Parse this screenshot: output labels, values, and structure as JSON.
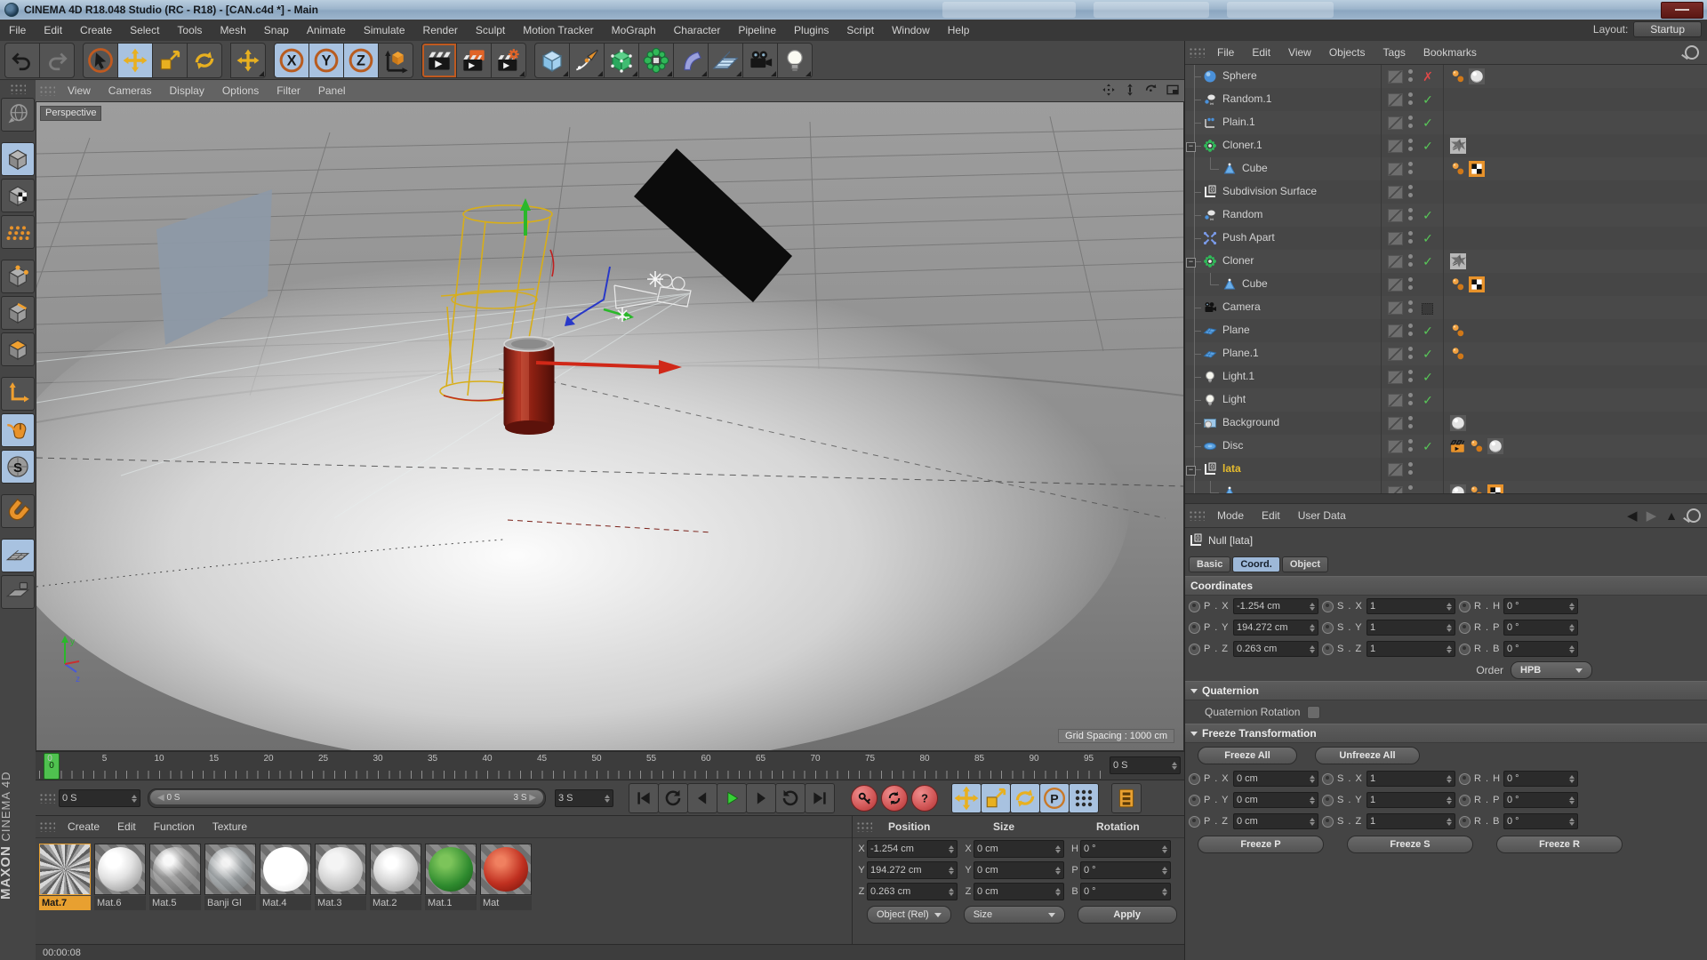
{
  "window": {
    "title": "CINEMA 4D R18.048 Studio (RC - R18) - [CAN.c4d *] - Main"
  },
  "menubar": {
    "items": [
      "File",
      "Edit",
      "Create",
      "Select",
      "Tools",
      "Mesh",
      "Snap",
      "Animate",
      "Simulate",
      "Render",
      "Sculpt",
      "Motion Tracker",
      "MoGraph",
      "Character",
      "Pipeline",
      "Plugins",
      "Script",
      "Window",
      "Help"
    ],
    "layout_label": "Layout:",
    "layout_value": "Startup"
  },
  "toolbar": {
    "tools": [
      {
        "name": "undo"
      },
      {
        "name": "redo",
        "disabled": true
      },
      {
        "name": "live-select"
      },
      {
        "name": "move",
        "active": true
      },
      {
        "name": "scale"
      },
      {
        "name": "rotate"
      },
      {
        "name": "last-tool-move"
      },
      {
        "name": "lock-x",
        "active": true
      },
      {
        "name": "lock-y",
        "active": true
      },
      {
        "name": "lock-z",
        "active": true
      },
      {
        "name": "coord-system"
      },
      {
        "name": "render-view",
        "framed": true
      },
      {
        "name": "render-picture-viewer"
      },
      {
        "name": "render-settings"
      },
      {
        "name": "primitive-cube"
      },
      {
        "name": "spline-pen"
      },
      {
        "name": "subdivision-surface"
      },
      {
        "name": "mograph"
      },
      {
        "name": "deformer"
      },
      {
        "name": "environment"
      },
      {
        "name": "scene-camera"
      },
      {
        "name": "scene-light"
      }
    ]
  },
  "left_toolbar": {
    "tools": [
      {
        "name": "convert-object"
      },
      {
        "name": "model-mode",
        "active": true
      },
      {
        "name": "texture-mode"
      },
      {
        "name": "workplane-paint"
      },
      {
        "name": "points-mode"
      },
      {
        "name": "edges-mode"
      },
      {
        "name": "polygons-mode"
      },
      {
        "name": "axis-mode"
      },
      {
        "name": "viewport-solo",
        "active": true
      },
      {
        "name": "snap",
        "active": true
      },
      {
        "name": "magnet-snap"
      },
      {
        "name": "workplane-lock",
        "active": true
      },
      {
        "name": "workplane"
      }
    ]
  },
  "viewport": {
    "menu_items": [
      "View",
      "Cameras",
      "Display",
      "Options",
      "Filter",
      "Panel"
    ],
    "camera_label": "Perspective",
    "grid_spacing": "Grid Spacing : 1000 cm",
    "corner_icons": [
      "pan-icon",
      "zoom-icon",
      "rotate-icon",
      "toggle-view-icon"
    ]
  },
  "timeline": {
    "tick_labels": [
      "0",
      "5",
      "10",
      "15",
      "20",
      "25",
      "30",
      "35",
      "40",
      "45",
      "50",
      "55",
      "60",
      "65",
      "70",
      "75",
      "80",
      "85",
      "90",
      "95"
    ],
    "playhead_value": "0",
    "end_field": "0 S",
    "current_field": "0 S",
    "range_start": "0 S",
    "range_end": "3 S",
    "duration_field": "3 S"
  },
  "object_manager": {
    "menu_items": [
      "File",
      "Edit",
      "View",
      "Objects",
      "Tags",
      "Bookmarks"
    ],
    "objects": [
      {
        "name": "Sphere",
        "icon": "sphere",
        "indent": 0,
        "expand": null,
        "state": "x",
        "tags": [
          "phong",
          "material"
        ]
      },
      {
        "name": "Random.1",
        "icon": "effector",
        "indent": 0,
        "expand": null,
        "state": "check",
        "tags": []
      },
      {
        "name": "Plain.1",
        "icon": "plain",
        "indent": 0,
        "expand": null,
        "state": "check",
        "tags": []
      },
      {
        "name": "Cloner.1",
        "icon": "cloner",
        "indent": 0,
        "expand": "minus",
        "state": "check",
        "tags": [
          "texture"
        ]
      },
      {
        "name": "Cube",
        "icon": "cone",
        "indent": 1,
        "expand": null,
        "state": "none",
        "tags": [
          "phong",
          "compositing"
        ]
      },
      {
        "name": "Subdivision Surface",
        "icon": "null",
        "indent": 0,
        "expand": null,
        "state": "none",
        "tags": []
      },
      {
        "name": "Random",
        "icon": "effector",
        "indent": 0,
        "expand": null,
        "state": "check",
        "tags": []
      },
      {
        "name": "Push Apart",
        "icon": "pushapart",
        "indent": 0,
        "expand": null,
        "state": "check",
        "tags": []
      },
      {
        "name": "Cloner",
        "icon": "cloner",
        "indent": 0,
        "expand": "minus",
        "state": "check",
        "tags": [
          "texture"
        ]
      },
      {
        "name": "Cube",
        "icon": "cone",
        "indent": 1,
        "expand": null,
        "state": "none",
        "tags": [
          "phong",
          "compositing"
        ]
      },
      {
        "name": "Camera",
        "icon": "camera",
        "indent": 0,
        "expand": null,
        "state": "cam",
        "tags": []
      },
      {
        "name": "Plane",
        "icon": "plane",
        "indent": 0,
        "expand": null,
        "state": "check",
        "tags": [
          "phong"
        ]
      },
      {
        "name": "Plane.1",
        "icon": "plane",
        "indent": 0,
        "expand": null,
        "state": "check",
        "tags": [
          "phong"
        ]
      },
      {
        "name": "Light.1",
        "icon": "light",
        "indent": 0,
        "expand": null,
        "state": "check",
        "tags": []
      },
      {
        "name": "Light",
        "icon": "light",
        "indent": 0,
        "expand": null,
        "state": "check",
        "tags": []
      },
      {
        "name": "Background",
        "icon": "background",
        "indent": 0,
        "expand": null,
        "state": "none",
        "tags": [
          "material"
        ]
      },
      {
        "name": "Disc",
        "icon": "disc",
        "indent": 0,
        "expand": null,
        "state": "check",
        "tags": [
          "render",
          "phong",
          "material"
        ]
      },
      {
        "name": "lata",
        "icon": "null",
        "indent": 0,
        "expand": "minus",
        "state": "none",
        "selected": true,
        "tags": []
      },
      {
        "name": "",
        "icon": "cone",
        "indent": 1,
        "expand": null,
        "state": "none",
        "tags": [
          "material",
          "phong",
          "compositing"
        ]
      }
    ]
  },
  "attribute_manager": {
    "menu_items": [
      "Mode",
      "Edit",
      "User Data"
    ],
    "object_title": "Null [lata]",
    "tabs": [
      {
        "label": "Basic",
        "active": false
      },
      {
        "label": "Coord.",
        "active": true
      },
      {
        "label": "Object",
        "active": false
      }
    ],
    "coordinates_section": "Coordinates",
    "coord_rows": [
      {
        "p_label": "P . X",
        "p_value": "-1.254 cm",
        "s_label": "S . X",
        "s_value": "1",
        "r_label": "R . H",
        "r_value": "0 °"
      },
      {
        "p_label": "P . Y",
        "p_value": "194.272 cm",
        "s_label": "S . Y",
        "s_value": "1",
        "r_label": "R . P",
        "r_value": "0 °"
      },
      {
        "p_label": "P . Z",
        "p_value": "0.263 cm",
        "s_label": "S . Z",
        "s_value": "1",
        "r_label": "R . B",
        "r_value": "0 °"
      }
    ],
    "order_label": "Order",
    "order_value": "HPB",
    "quaternion_section": "Quaternion",
    "quaternion_checkbox_label": "Quaternion Rotation",
    "freeze_section": "Freeze Transformation",
    "freeze_all": "Freeze All",
    "unfreeze_all": "Unfreeze All",
    "freeze_rows": [
      {
        "p_label": "P . X",
        "p_value": "0 cm",
        "s_label": "S . X",
        "s_value": "1",
        "r_label": "R . H",
        "r_value": "0 °"
      },
      {
        "p_label": "P . Y",
        "p_value": "0 cm",
        "s_label": "S . Y",
        "s_value": "1",
        "r_label": "R . P",
        "r_value": "0 °"
      },
      {
        "p_label": "P . Z",
        "p_value": "0 cm",
        "s_label": "S . Z",
        "s_value": "1",
        "r_label": "R . B",
        "r_value": "0 °"
      }
    ],
    "freeze_p": "Freeze P",
    "freeze_s": "Freeze S",
    "freeze_r": "Freeze R"
  },
  "materials": {
    "menu_items": [
      "Create",
      "Edit",
      "Function",
      "Texture"
    ],
    "items": [
      {
        "name": "Mat.7",
        "type": "noise",
        "selected": true
      },
      {
        "name": "Mat.6",
        "type": "white"
      },
      {
        "name": "Mat.5",
        "type": "glass"
      },
      {
        "name": "Banji Gl",
        "type": "glass2"
      },
      {
        "name": "Mat.4",
        "type": "whiteflat"
      },
      {
        "name": "Mat.3",
        "type": "gray"
      },
      {
        "name": "Mat.2",
        "type": "gray2"
      },
      {
        "name": "Mat.1",
        "type": "green"
      },
      {
        "name": "Mat",
        "type": "red"
      }
    ]
  },
  "coordinate_manager": {
    "headers": [
      "Position",
      "Size",
      "Rotation"
    ],
    "rows": [
      {
        "p_label": "X",
        "p_value": "-1.254 cm",
        "s_label": "X",
        "s_value": "0 cm",
        "r_label": "H",
        "r_value": "0 °"
      },
      {
        "p_label": "Y",
        "p_value": "194.272 cm",
        "s_label": "Y",
        "s_value": "0 cm",
        "r_label": "P",
        "r_value": "0 °"
      },
      {
        "p_label": "Z",
        "p_value": "0.263 cm",
        "s_label": "Z",
        "s_value": "0 cm",
        "r_label": "B",
        "r_value": "0 °"
      }
    ],
    "mode_dropdown": "Object (Rel)",
    "size_dropdown": "Size",
    "apply_button": "Apply"
  },
  "status": {
    "time": "00:00:08"
  },
  "brand": {
    "line1": "MAXON",
    "line2": "CINEMA 4D"
  }
}
